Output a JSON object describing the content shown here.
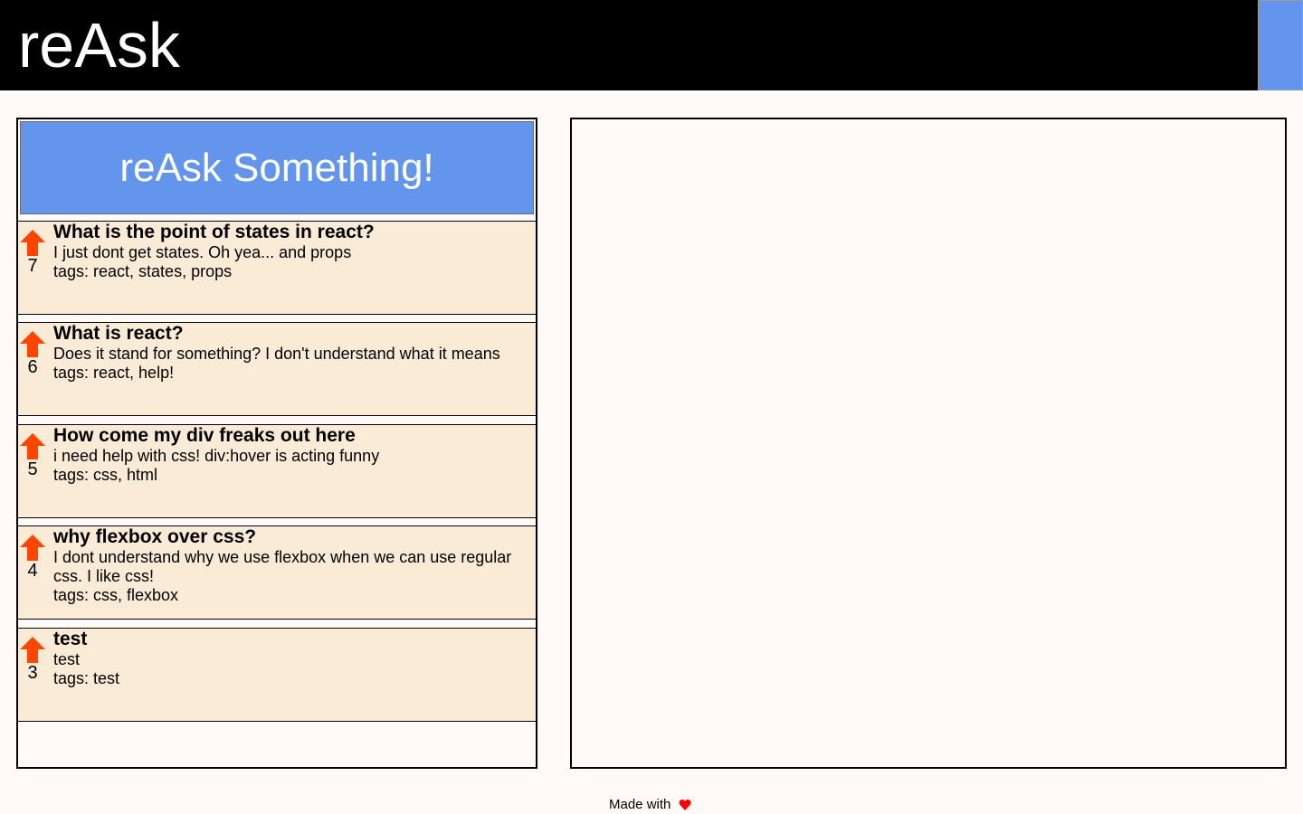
{
  "header": {
    "brand": "reAsk",
    "accent_color": "#6495ed"
  },
  "ask_button": {
    "label": "reAsk Something!"
  },
  "questions": [
    {
      "votes": "7",
      "title": "What is the point of states in react?",
      "body": "I just dont get states. Oh yea... and props",
      "tags": "tags: react, states, props"
    },
    {
      "votes": "6",
      "title": "What is react?",
      "body": "Does it stand for something? I don't understand what it means",
      "tags": "tags: react, help!"
    },
    {
      "votes": "5",
      "title": "How come my div freaks out here",
      "body": "i need help with css! div:hover is acting funny",
      "tags": "tags: css, html"
    },
    {
      "votes": "4",
      "title": "why flexbox over css?",
      "body": "I dont understand why we use flexbox when we can use regular css. I like css!",
      "tags": "tags: css, flexbox"
    },
    {
      "votes": "3",
      "title": "test",
      "body": "test",
      "tags": "tags: test"
    }
  ],
  "icons": {
    "upvote": "up-arrow-icon",
    "heart": "heart-icon"
  },
  "colors": {
    "question_bg": "#faebd7",
    "upvote_arrow": "#ff4500",
    "heart": "#ff0000"
  },
  "footer": {
    "text": "Made with"
  }
}
